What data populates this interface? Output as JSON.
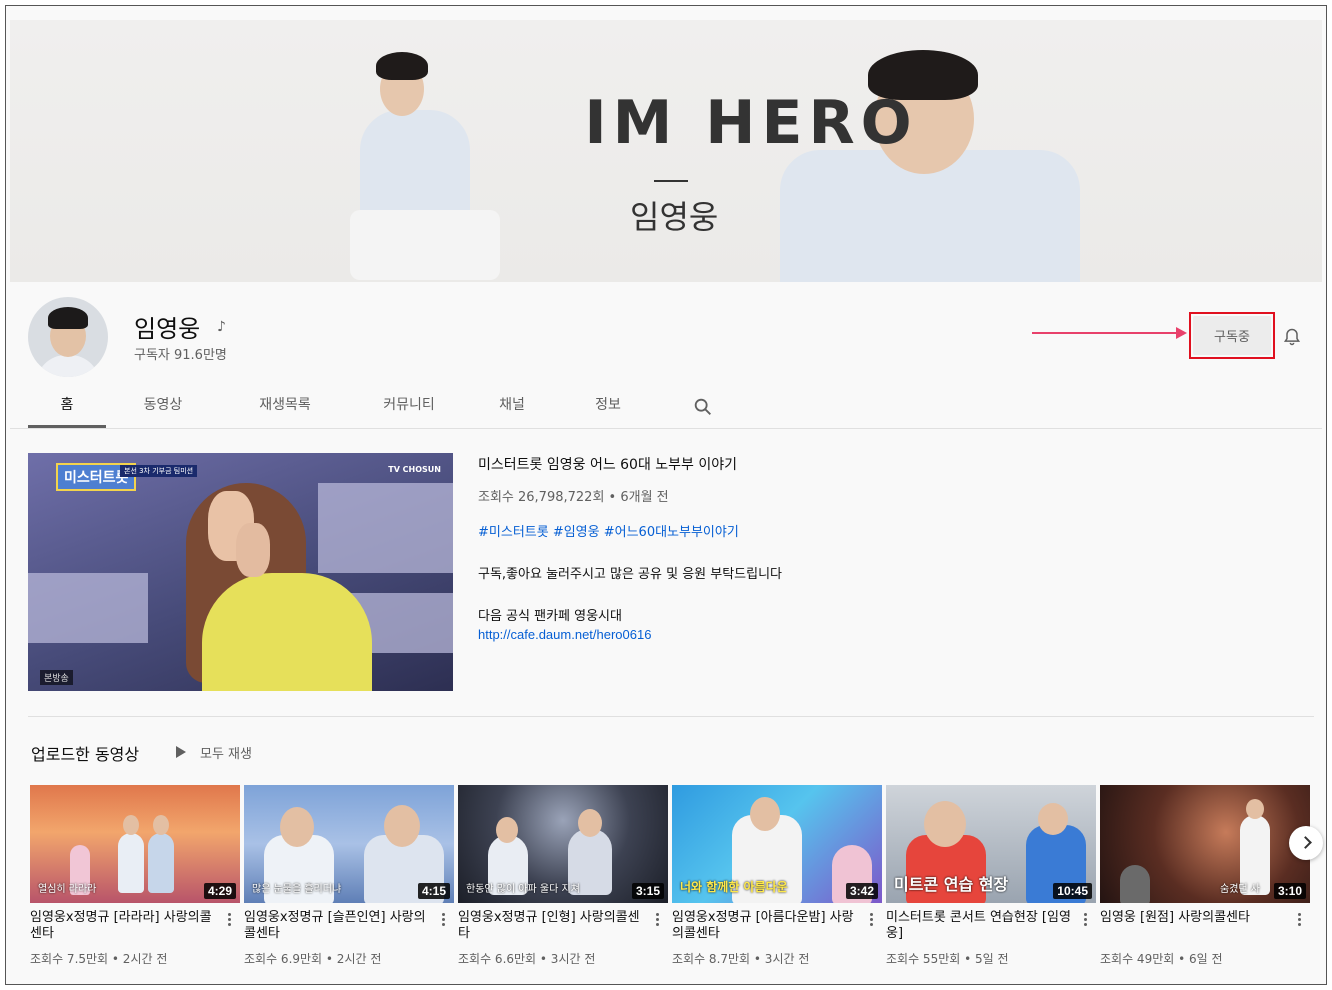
{
  "banner": {
    "title": "IM HERO",
    "subtitle": "임영웅"
  },
  "channel": {
    "name": "임영웅",
    "note_symbol": "♪",
    "subscribers": "구독자 91.6만명",
    "subscribe_label": "구독중"
  },
  "tabs": [
    {
      "label": "홈"
    },
    {
      "label": "동영상"
    },
    {
      "label": "재생목록"
    },
    {
      "label": "커뮤니티"
    },
    {
      "label": "채널"
    },
    {
      "label": "정보"
    }
  ],
  "featured": {
    "title": "미스터트롯 임영웅 어느 60대 노부부 이야기",
    "meta": "조회수 26,798,722회 • 6개월 전",
    "tags": "#미스터트롯 #임영웅 #어느60대노부부이야기",
    "desc1": "구독,좋아요 눌러주시고 많은 공유 및 응원 부탁드립니다",
    "desc2": "다음 공식 팬카페 영웅시대",
    "link": "http://cafe.daum.net/hero0616",
    "thumb_logo": "미스터트롯",
    "thumb_sub": "본선 3차 기부금 팀미션",
    "thumb_tv": "TV CHOSUN",
    "thumb_badge": "본방송"
  },
  "uploads": {
    "title": "업로드한 동영상",
    "play_all": "모두 재생",
    "videos": [
      {
        "title": "임영웅x정명규 [라라라] 사랑의콜센타",
        "meta": "조회수 7.5만회 • 2시간 전",
        "duration": "4:29",
        "caption": "열심히 라라라"
      },
      {
        "title": "임영웅x정명규 [슬픈인연] 사랑의콜센타",
        "meta": "조회수 6.9만회 • 2시간 전",
        "duration": "4:15",
        "caption": "많은 눈물을 흘리더냐"
      },
      {
        "title": "임영웅x정명규 [인형] 사랑의콜센타",
        "meta": "조회수 6.6만회 • 3시간 전",
        "duration": "3:15",
        "caption": "한동안 많이 아파 울다 지쳐"
      },
      {
        "title": "임영웅x정명규 [아름다운밤] 사랑의콜센타",
        "meta": "조회수 8.7만회 • 3시간 전",
        "duration": "3:42",
        "caption": "너와 함께한 아름다운"
      },
      {
        "title": "미스터트롯 콘서트 연습현장 [임영웅]",
        "meta": "조회수 55만회 • 5일 전",
        "duration": "10:45",
        "caption": "미트콘 연습 현장"
      },
      {
        "title": "임영웅 [원점] 사랑의콜센타",
        "meta": "조회수 49만회 • 6일 전",
        "duration": "3:10",
        "caption": "숨겼던 사"
      }
    ]
  },
  "colors": {
    "accent_link": "#065fd4",
    "highlight_box": "#e0101f",
    "arrow": "#e8416b"
  },
  "icons": [
    "music-note-icon",
    "bell-icon",
    "search-icon",
    "play-icon",
    "chevron-right-icon",
    "more-vert-icon"
  ]
}
